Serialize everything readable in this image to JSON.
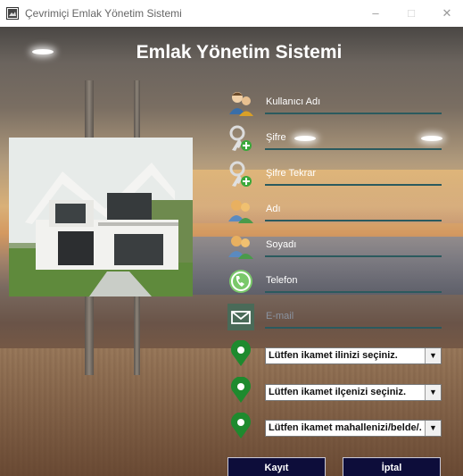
{
  "window": {
    "title": "Çevrimiçi Emlak Yönetim Sistemi",
    "minimize": "–",
    "maximize": "□",
    "close": "✕"
  },
  "main": {
    "heading": "Emlak Yönetim Sistemi"
  },
  "form": {
    "username": {
      "label": "Kullanıcı Adı",
      "icon": "users-icon"
    },
    "password": {
      "label": "Şifre",
      "icon": "key-add-icon"
    },
    "password_repeat": {
      "label": "Şifre Tekrar",
      "icon": "key-add-icon"
    },
    "first_name": {
      "label": "Adı",
      "icon": "people-icon"
    },
    "last_name": {
      "label": "Soyadı",
      "icon": "people-icon"
    },
    "phone": {
      "label": "Telefon",
      "icon": "phone-icon"
    },
    "email": {
      "label": "E-mail",
      "icon": "mail-icon"
    },
    "province": {
      "selected": "Lütfen ikamet ilinizi seçiniz.",
      "icon": "location-pin-icon"
    },
    "district": {
      "selected": "Lütfen ikamet ilçenizi seçiniz.",
      "icon": "location-pin-icon"
    },
    "neighborhood": {
      "selected": "Lütfen ikamet mahallenizi/belde/...",
      "icon": "location-pin-icon"
    }
  },
  "buttons": {
    "register": "Kayıt",
    "cancel": "İptal"
  },
  "colors": {
    "button_bg": "#0d0d3a",
    "field_line": "#2b5a5e",
    "pin_green": "#1e8a2e"
  }
}
